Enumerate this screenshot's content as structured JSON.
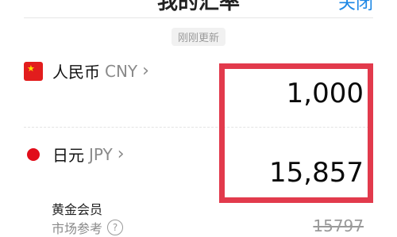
{
  "header": {
    "title": "我的汇率",
    "close_label": "关闭"
  },
  "updated_badge": "刚刚更新",
  "currencies": [
    {
      "name": "人民币",
      "code": "CNY",
      "amount": "1,000",
      "flag_icon": "china-flag-icon"
    },
    {
      "name": "日元",
      "code": "JPY",
      "amount": "15,857",
      "flag_icon": "japan-flag-icon"
    }
  ],
  "gold_member": {
    "label": "黄金会员"
  },
  "market_reference": {
    "label": "市场参考",
    "value": "15797"
  },
  "colors": {
    "highlight_border": "#e23a4c",
    "accent": "#1e88e5"
  }
}
